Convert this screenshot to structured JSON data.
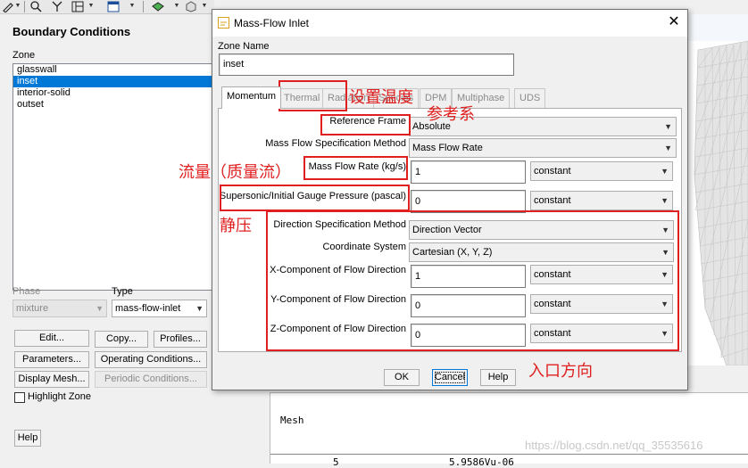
{
  "toolbar": {
    "icons": [
      "pencil-icon",
      "zoom-icon",
      "axes-icon",
      "layout-icon",
      "window-icon",
      "view-icon",
      "cube-icon",
      "refresh-icon",
      "warning-icon",
      "swap-icon",
      "mode-icon"
    ]
  },
  "panel": {
    "title": "Boundary Conditions",
    "zone_label": "Zone",
    "zones": [
      "glasswall",
      "inset",
      "interior-solid",
      "outset"
    ],
    "selected_zone": "inset",
    "phase_label": "Phase",
    "phase_value": "mixture",
    "type_label": "Type",
    "type_value": "mass-flow-inlet",
    "buttons": {
      "edit": "Edit...",
      "copy": "Copy...",
      "profiles": "Profiles...",
      "parameters": "Parameters...",
      "operating_conditions": "Operating Conditions...",
      "display_mesh": "Display Mesh...",
      "periodic_conditions": "Periodic Conditions..."
    },
    "highlight_zone": "Highlight Zone",
    "help": "Help"
  },
  "dialog": {
    "title": "Mass-Flow Inlet",
    "close": "✕",
    "zone_name_label": "Zone Name",
    "zone_name": "inset",
    "tabs": [
      "Momentum",
      "Thermal",
      "Radiation",
      "Species",
      "DPM",
      "Multiphase",
      "UDS"
    ],
    "active_tab": "Momentum",
    "fields": {
      "reference_frame_label": "Reference Frame",
      "reference_frame": "Absolute",
      "mass_flow_method_label": "Mass Flow Specification Method",
      "mass_flow_method": "Mass Flow Rate",
      "mass_flow_rate_label": "Mass Flow Rate (kg/s)",
      "mass_flow_rate": "1",
      "mass_flow_rate_mode": "constant",
      "gauge_pressure_label": "Supersonic/Initial Gauge Pressure (pascal)",
      "gauge_pressure": "0",
      "gauge_pressure_mode": "constant",
      "direction_method_label": "Direction Specification Method",
      "direction_method": "Direction Vector",
      "coordinate_system_label": "Coordinate System",
      "coordinate_system": "Cartesian (X, Y, Z)",
      "x_component_label": "X-Component of Flow Direction",
      "x_component": "1",
      "x_mode": "constant",
      "y_component_label": "Y-Component of Flow Direction",
      "y_component": "0",
      "y_mode": "constant",
      "z_component_label": "Z-Component of Flow Direction",
      "z_component": "0",
      "z_mode": "constant"
    },
    "buttons": {
      "ok": "OK",
      "cancel": "Cancel",
      "help": "Help"
    }
  },
  "annotations": {
    "thermal": "设置温度",
    "reference_frame": "参考系",
    "mass_flow": "流量（质量流）",
    "pressure": "静压",
    "direction": "入口方向"
  },
  "console": {
    "title": "Mesh",
    "row": [
      "5",
      "5.9586Vu-06"
    ]
  },
  "watermark": "https://blog.csdn.net/qq_35535616",
  "colors": {
    "accent_red": "#e02020",
    "selection_blue": "#0078d7"
  }
}
